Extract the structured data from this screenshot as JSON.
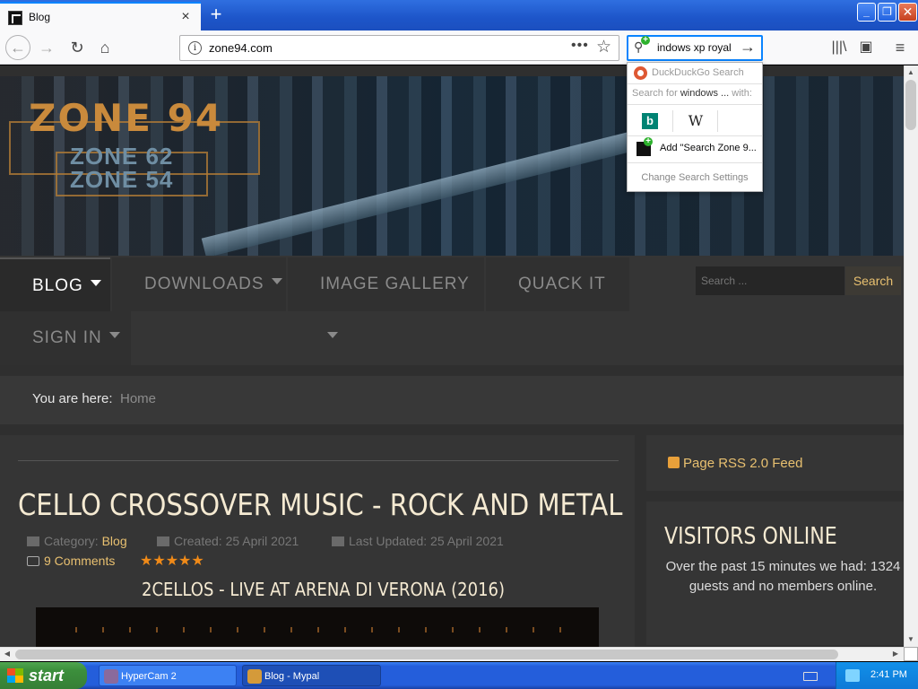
{
  "browser": {
    "tab_title": "Blog",
    "tab_close": "×",
    "new_tab": "+",
    "window_controls": {
      "minimize": "_",
      "maximize": "❐",
      "close": "✕"
    },
    "url": "zone94.com",
    "page_actions": "•••",
    "bookmark_star": "☆",
    "search_value": "indows xp royal",
    "search_go": "→",
    "nav_glyphs": {
      "back": "←",
      "forward": "→",
      "reload": "↻",
      "home": "⌂",
      "library": "|||\\",
      "sidebar": "▣",
      "menu": "≡",
      "info": "i",
      "search_engine": "⚲"
    },
    "icons": [
      "back-arrow-icon",
      "forward-arrow-icon",
      "reload-icon",
      "home-icon",
      "info-icon",
      "bookmark-star-icon",
      "library-icon",
      "sidebar-icon",
      "hamburger-menu-icon"
    ]
  },
  "search_popup": {
    "engine_label": "DuckDuckGo Search",
    "search_for_prefix": "Search for ",
    "search_for_query": "windows ...",
    "search_for_suffix": " with:",
    "bing_glyph": "b",
    "wiki_glyph": "W",
    "add_engine": "Add \"Search Zone 9...",
    "change_settings": "Change Search Settings"
  },
  "site": {
    "logo": {
      "main": "ZONE 94",
      "sub1": "ZONE 62",
      "sub2": "ZONE 54"
    },
    "nav": {
      "blog": "BLOG",
      "downloads": "DOWNLOADS",
      "image_gallery": "IMAGE GALLERY",
      "quack_it": "QUACK IT",
      "sign_in": "SIGN IN",
      "search_placeholder": "Search ...",
      "search_button": "Search"
    },
    "breadcrumb": {
      "label": "You are here:",
      "home": "Home"
    },
    "article": {
      "title": "CELLO CROSSOVER MUSIC - ROCK AND METAL",
      "category_label": "Category: ",
      "category_link": "Blog",
      "created": "Created: 25 April 2021",
      "updated": "Last Updated: 25 April 2021",
      "comments": "9 Comments",
      "rating": "★★★★★",
      "rating_value": 5,
      "video_title": "2CELLOS - LIVE AT ARENA DI VERONA (2016)"
    },
    "sidebar": {
      "rss": "Page RSS 2.0 Feed",
      "visitors_title": "VISITORS ONLINE",
      "visitors_text": "Over the past 15 minutes we had: 1324 guests and no members online."
    }
  },
  "scrollbars": {
    "up": "▲",
    "down": "▼",
    "left": "◀",
    "right": "▶"
  },
  "taskbar": {
    "start": "start",
    "tasks": [
      {
        "label": "HyperCam 2"
      },
      {
        "label": "Blog - Mypal"
      }
    ],
    "clock": "2:41 PM"
  },
  "colors": {
    "accent_focus": "#0a84ff",
    "site_link": "#e8c070",
    "star_rating": "#f08a18",
    "page_bg": "#2f2f2f",
    "xp_taskbar": "#245edb",
    "xp_start": "#3c8f3c"
  }
}
